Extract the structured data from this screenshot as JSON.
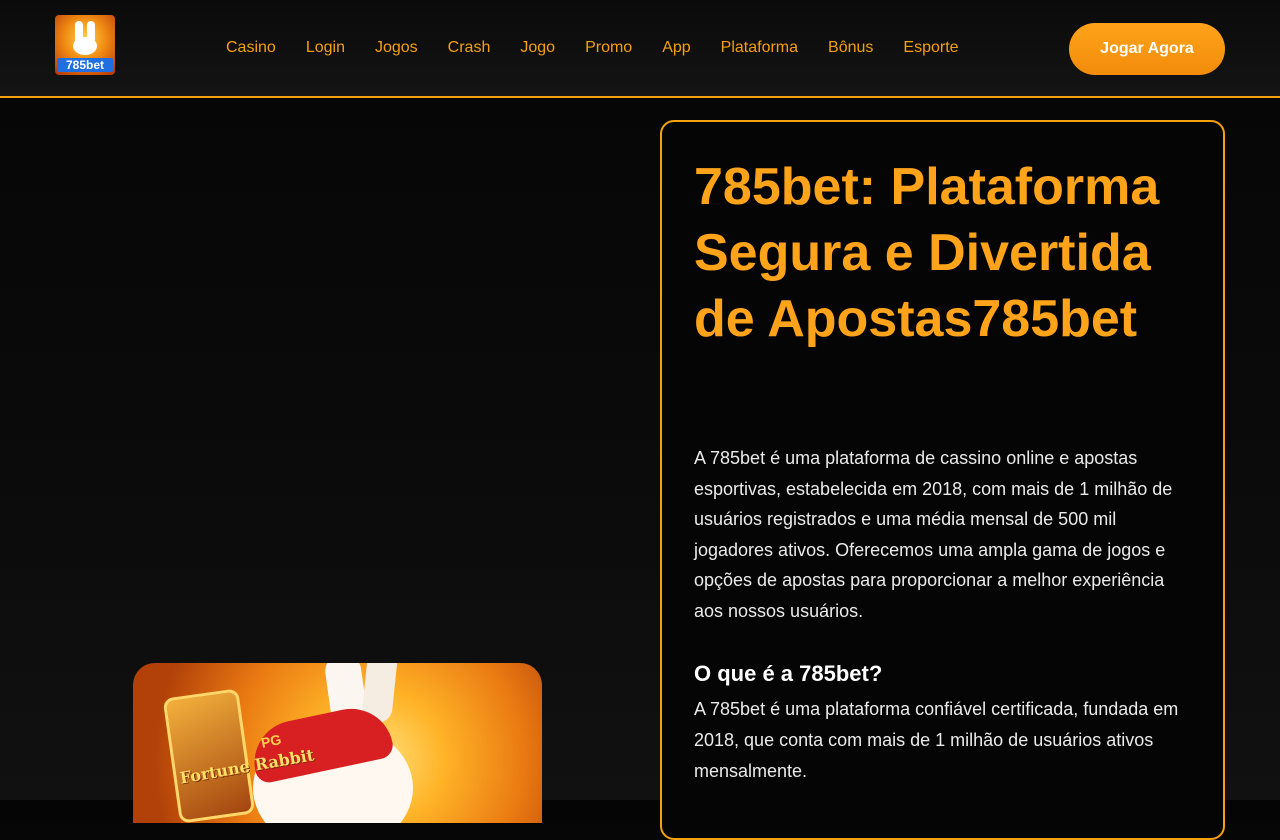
{
  "header": {
    "logo_text": "785bet",
    "nav": [
      "Casino",
      "Login",
      "Jogos",
      "Crash",
      "Jogo",
      "Promo",
      "App",
      "Plataforma",
      "Bônus",
      "Esporte"
    ],
    "cta_label": "Jogar Agora"
  },
  "game_card": {
    "title": "Fortune Rabbit",
    "cap_label": "PG"
  },
  "main": {
    "title": "785bet: Plataforma Segura e Divertida de Apostas785bet",
    "intro": "A 785bet é uma plataforma de cassino online e apostas esportivas, estabelecida em 2018, com mais de 1 milhão de usuários registrados e uma média mensal de 500 mil jogadores ativos. Oferecemos uma ampla gama de jogos e opções de apostas para proporcionar a melhor experiência aos nossos usuários.",
    "section_title": "O que é a 785bet?",
    "section_text": "A 785bet é uma plataforma confiável certificada, fundada em 2018, que conta com mais de 1 milhão de usuários ativos mensalmente."
  },
  "colors": {
    "accent": "#f5a00e",
    "background": "#0a0a0a",
    "text": "#ffffff"
  }
}
